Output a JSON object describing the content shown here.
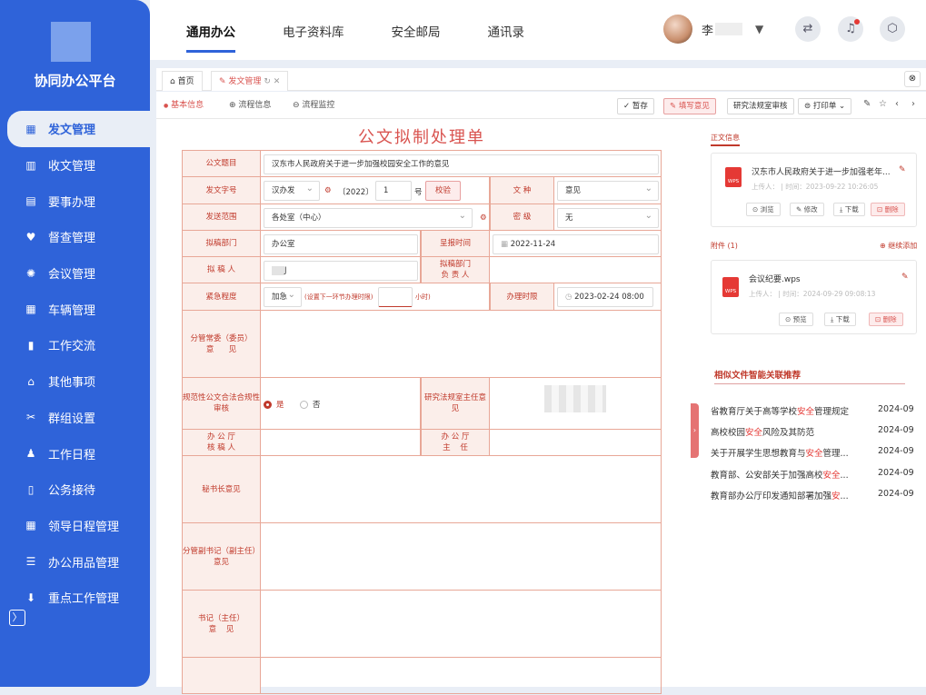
{
  "app": {
    "title": "协同办公平台"
  },
  "sidebar": {
    "items": [
      {
        "label": "发文管理",
        "icon": "grid-icon",
        "glyph": "▦"
      },
      {
        "label": "收文管理",
        "icon": "chart-icon",
        "glyph": "▥"
      },
      {
        "label": "要事办理",
        "icon": "monitor-icon",
        "glyph": "▤"
      },
      {
        "label": "督查管理",
        "icon": "heart-icon",
        "glyph": "♥"
      },
      {
        "label": "会议管理",
        "icon": "atom-icon",
        "glyph": "✺"
      },
      {
        "label": "车辆管理",
        "icon": "grid-icon",
        "glyph": "▦"
      },
      {
        "label": "工作交流",
        "icon": "doc-icon",
        "glyph": "▮"
      },
      {
        "label": "其他事项",
        "icon": "bank-icon",
        "glyph": "⌂"
      },
      {
        "label": "群组设置",
        "icon": "tools-icon",
        "glyph": "✂"
      },
      {
        "label": "工作日程",
        "icon": "user-clock-icon",
        "glyph": "♟"
      },
      {
        "label": "公务接待",
        "icon": "file-icon",
        "glyph": "▯"
      },
      {
        "label": "领导日程管理",
        "icon": "calendar-icon",
        "glyph": "▦"
      },
      {
        "label": "办公用品管理",
        "icon": "list-icon",
        "glyph": "☰"
      },
      {
        "label": "重点工作管理",
        "icon": "download-icon",
        "glyph": "⬇"
      }
    ],
    "collapse_glyph": "〉"
  },
  "topnav": {
    "items": [
      "通用办公",
      "电子资料库",
      "安全邮局",
      "通讯录"
    ]
  },
  "user": {
    "name": "李"
  },
  "tabs": [
    {
      "label": "首页",
      "icon": "⌂"
    },
    {
      "label": "发文管理",
      "icon": "✎"
    }
  ],
  "subtabs": [
    {
      "label": "基本信息",
      "icon": "●"
    },
    {
      "label": "流程信息",
      "icon": "⊕"
    },
    {
      "label": "流程监控",
      "icon": "⊖"
    }
  ],
  "actions": {
    "save": "暂存",
    "opinion": "填写意见",
    "review": "研究法规室审核",
    "print": "打印单"
  },
  "form": {
    "title": "公文拟制处理单",
    "labels": {
      "subject": "公文题目",
      "doc_no": "发文字号",
      "kind": "文  种",
      "scope": "发送范围",
      "secret": "密  级",
      "dept": "拟稿部门",
      "submit_time": "呈报时间",
      "drafter": "拟 稿 人",
      "dept_head": "拟稿部门\n负 责 人",
      "urgency": "紧急程度",
      "deadline": "办理时限",
      "committee": "分管常委（委员）\n意      见",
      "legal": "规范性公文合法合规性审核",
      "legal_head": "研究法规室主任意见",
      "office_drafter": "办 公 厅\n核 稿 人",
      "office_head": "办 公 厅\n主    任",
      "secretary": "秘书长意见",
      "deputy_secretary": "分管副书记（副主任）\n意见",
      "party_secretary": "书记（主任）\n意    见"
    },
    "values": {
      "subject": "汉东市人民政府关于进一步加强校园安全工作的意见",
      "doc_prefix": "汉办发",
      "doc_year": "〔2022〕",
      "doc_num": "1",
      "doc_suffix": "号",
      "check_btn": "校验",
      "kind": "意见",
      "scope": "各处室（中心）",
      "secret": "无",
      "dept": "办公室",
      "submit_time": "2022-11-24",
      "drafter": "J",
      "urgency": "加急",
      "urgency_hint": "(设置下一环节办理时限)",
      "hours_suffix": "小时)",
      "deadline": "2023-02-24 08:00",
      "radio_yes": "是",
      "radio_no": "否"
    }
  },
  "right": {
    "main_text_header": "正文信息",
    "main_file": {
      "name": "汉东市人民政府关于进一步加强老年...",
      "meta": "上传人：     | 时间：2023-09-22 10:26:05",
      "buttons": [
        "浏览",
        "修改",
        "下载",
        "删除"
      ]
    },
    "attach_header": "附件 (1)",
    "attach_add": "继续添加",
    "attach_file": {
      "name": "会议纪要.wps",
      "meta": "上传人：     | 时间：2024-09-29 09:08:13",
      "buttons": [
        "预览",
        "下载",
        "删除"
      ]
    },
    "rec_header": "相似文件智能关联推荐",
    "recs": [
      {
        "pre": "省教育厅关于高等学校",
        "hl": "安全",
        "post": "管理规定",
        "date": "2024-09"
      },
      {
        "pre": "高校校园",
        "hl": "安全",
        "post": "风险及其防范",
        "date": "2024-09"
      },
      {
        "pre": "关于开展学生思想教育与",
        "hl": "安全",
        "post": "管理...",
        "date": "2024-09"
      },
      {
        "pre": "教育部、公安部关于加强高校",
        "hl": "安全",
        "post": "...",
        "date": "2024-09"
      },
      {
        "pre": "教育部办公厅印发通知部署加强",
        "hl": "安",
        "post": "...",
        "date": "2024-09"
      }
    ]
  },
  "icons": {
    "wps": "WPS"
  }
}
